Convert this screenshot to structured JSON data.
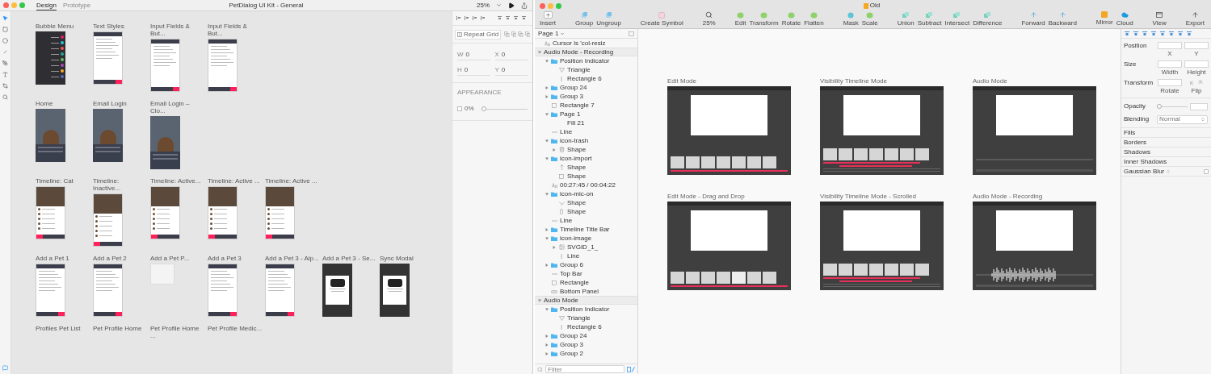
{
  "left_window": {
    "tabs": [
      {
        "label": "Design",
        "selected": true
      },
      {
        "label": "Prototype",
        "selected": false
      }
    ],
    "title": "PetDialog UI Kit - General",
    "zoom": "25%",
    "rows": [
      {
        "artboards": [
          {
            "label": "Bubble Menu",
            "kind": "dark"
          },
          {
            "label": "Text Styles",
            "kind": "light"
          },
          {
            "label": "Input Fields & But...",
            "kind": "light"
          },
          {
            "label": "Input Fields & But...",
            "kind": "light"
          }
        ]
      },
      {
        "artboards": [
          {
            "label": "Home",
            "kind": "photo"
          },
          {
            "label": "Email Login",
            "kind": "photo"
          },
          {
            "label": "Email Login – Clo...",
            "kind": "photo"
          }
        ]
      },
      {
        "artboards": [
          {
            "label": "Timeline: Cat",
            "kind": "timeline"
          },
          {
            "label": "Timeline: Inactive...",
            "kind": "timeline"
          },
          {
            "label": "Timeline: Active...",
            "kind": "timeline"
          },
          {
            "label": "Timeline: Active ...",
            "kind": "timeline"
          },
          {
            "label": "Timeline: Active ...",
            "kind": "timeline"
          }
        ]
      },
      {
        "artboards": [
          {
            "label": "Add a Pet 1",
            "kind": "light"
          },
          {
            "label": "Add a Pet 2",
            "kind": "light"
          },
          {
            "label": "Add a Pet P...",
            "kind": "blank"
          },
          {
            "label": "Add a Pet 3",
            "kind": "light"
          },
          {
            "label": "Add a Pet 3 - Alp...",
            "kind": "light"
          },
          {
            "label": "Add a Pet 3 - Se...",
            "kind": "modal"
          },
          {
            "label": "Sync Modal",
            "kind": "modal"
          }
        ]
      },
      {
        "artboards": [
          {
            "label": "Profiles Pet List"
          },
          {
            "label": "Pet Profile Home"
          },
          {
            "label": "Pet Profile Home ..."
          },
          {
            "label": "Pet Profile Medic..."
          }
        ]
      }
    ],
    "inspector": {
      "repeat_grid": "Repeat Grid",
      "fields": [
        {
          "label": "W",
          "value": "0"
        },
        {
          "label": "X",
          "value": "0"
        },
        {
          "label": "H",
          "value": "0"
        },
        {
          "label": "Y",
          "value": "0"
        }
      ],
      "appearance": {
        "heading": "APPEARANCE",
        "checked": false,
        "opacity": "0%",
        "level": 0
      }
    }
  },
  "right_window": {
    "title": "Old",
    "toolbar_groups": [
      {
        "items": [
          {
            "label": "Insert",
            "kind": "insert"
          }
        ]
      },
      {
        "items": [
          {
            "label": "Group",
            "kind": "layer"
          },
          {
            "label": "Ungroup",
            "kind": "layer"
          }
        ]
      },
      {
        "items": [
          {
            "label": "Create Symbol",
            "kind": "symbol"
          }
        ]
      },
      {
        "items": [
          {
            "label": "25%",
            "kind": "zoom"
          }
        ]
      },
      {
        "items": [
          {
            "label": "Edit",
            "kind": "path"
          },
          {
            "label": "Transform",
            "kind": "path"
          },
          {
            "label": "Rotate",
            "kind": "path"
          },
          {
            "label": "Flatten",
            "kind": "path"
          }
        ]
      },
      {
        "items": [
          {
            "label": "Mask",
            "kind": "mask"
          },
          {
            "label": "Scale",
            "kind": "path"
          }
        ]
      },
      {
        "items": [
          {
            "label": "Union",
            "kind": "boolean"
          },
          {
            "label": "Subtract",
            "kind": "boolean"
          },
          {
            "label": "Intersect",
            "kind": "boolean"
          },
          {
            "label": "Difference",
            "kind": "boolean"
          }
        ]
      },
      {
        "items": [
          {
            "label": "Forward",
            "kind": "arrange"
          },
          {
            "label": "Backward",
            "kind": "arrange"
          }
        ]
      },
      {
        "items": [
          {
            "label": "Mirror",
            "kind": "mirror"
          },
          {
            "label": "Cloud",
            "kind": "cloud"
          }
        ]
      },
      {
        "items": [
          {
            "label": "View",
            "kind": "view"
          }
        ]
      },
      {
        "items": [
          {
            "label": "Export",
            "kind": "export"
          }
        ]
      }
    ],
    "page": "Page 1",
    "layers": [
      {
        "name": "Cursor is 'col-resiz",
        "kind": "text"
      },
      {
        "name": "Audio Mode - Recording",
        "kind": "artboard",
        "expanded": true,
        "children": [
          {
            "name": "Position Indicator",
            "kind": "group",
            "expanded": true,
            "children": [
              {
                "name": "Triangle",
                "kind": "triangle"
              },
              {
                "name": "Rectangle 6",
                "kind": "vline"
              }
            ]
          },
          {
            "name": "Group 24",
            "kind": "group",
            "expanded": false
          },
          {
            "name": "Group 3",
            "kind": "group",
            "expanded": false
          },
          {
            "name": "Rectangle 7",
            "kind": "rect"
          },
          {
            "name": "Page 1",
            "kind": "group",
            "expanded": true,
            "children": [
              {
                "name": "Fill 21",
                "kind": "plain"
              }
            ]
          },
          {
            "name": "Line",
            "kind": "hline"
          },
          {
            "name": "icon-trash",
            "kind": "group",
            "expanded": true,
            "children": [
              {
                "name": "Shape",
                "kind": "trash",
                "expanded": false
              }
            ]
          },
          {
            "name": "icon-import",
            "kind": "group",
            "expanded": true,
            "children": [
              {
                "name": "Shape",
                "kind": "pin"
              },
              {
                "name": "Shape",
                "kind": "rect"
              }
            ]
          },
          {
            "name": "00:27:45 / 00:04:22",
            "kind": "text"
          },
          {
            "name": "icon-mic-on",
            "kind": "group",
            "expanded": true,
            "children": [
              {
                "name": "Shape",
                "kind": "cup"
              },
              {
                "name": "Shape",
                "kind": "capsule"
              }
            ]
          },
          {
            "name": "Line",
            "kind": "hline"
          },
          {
            "name": "Timeline Title Bar",
            "kind": "group",
            "expanded": false
          },
          {
            "name": "icon-image",
            "kind": "group",
            "expanded": true,
            "children": [
              {
                "name": "SVGID_1_",
                "kind": "image",
                "expanded": false
              },
              {
                "name": "Line",
                "kind": "vline"
              }
            ]
          },
          {
            "name": "Group 6",
            "kind": "group",
            "expanded": false
          },
          {
            "name": "Top Bar",
            "kind": "hline"
          },
          {
            "name": "Rectangle",
            "kind": "rect"
          },
          {
            "name": "Bottom Panel",
            "kind": "slab"
          }
        ]
      },
      {
        "name": "Audio Mode",
        "kind": "artboard",
        "expanded": true,
        "children": [
          {
            "name": "Position Indicator",
            "kind": "group",
            "expanded": true,
            "children": [
              {
                "name": "Triangle",
                "kind": "triangle"
              },
              {
                "name": "Rectangle 6",
                "kind": "vline"
              }
            ]
          },
          {
            "name": "Group 24",
            "kind": "group",
            "expanded": false
          },
          {
            "name": "Group 3",
            "kind": "group",
            "expanded": false
          },
          {
            "name": "Group 2",
            "kind": "group",
            "expanded": false
          }
        ]
      }
    ],
    "filter_placeholder": "Filter",
    "artboards": [
      {
        "label": "Edit Mode",
        "kind": "edit"
      },
      {
        "label": "Visibility Timeline Mode",
        "kind": "timeline"
      },
      {
        "label": "Audio Mode",
        "kind": "audio"
      },
      {
        "label": "Edit Mode - Drag and Drop",
        "kind": "drag"
      },
      {
        "label": "Visibility Timeline Mode - Scrolled",
        "kind": "timeline"
      },
      {
        "label": "Audio Mode - Recording",
        "kind": "recording"
      }
    ],
    "inspector": {
      "rows": [
        {
          "label": "Position",
          "fields": [
            {
              "caption": "X",
              "kind": "input"
            },
            {
              "caption": "Y",
              "kind": "input"
            }
          ]
        },
        {
          "label": "Size",
          "fields": [
            {
              "caption": "Width",
              "kind": "input"
            },
            {
              "caption": "Height",
              "kind": "input"
            }
          ]
        },
        {
          "label": "Transform",
          "fields": [
            {
              "caption": "Rotate",
              "kind": "input"
            },
            {
              "caption": "Flip",
              "kind": "flip"
            }
          ]
        }
      ],
      "opacity": {
        "label": "Opacity",
        "level": 0
      },
      "blending": {
        "label": "Blending",
        "value": "Normal"
      },
      "sections": [
        "Fills",
        "Borders",
        "Shadows",
        "Inner Shadows"
      ],
      "gaussian_blur": {
        "label": "Gaussian Blur",
        "checked": false
      }
    }
  }
}
